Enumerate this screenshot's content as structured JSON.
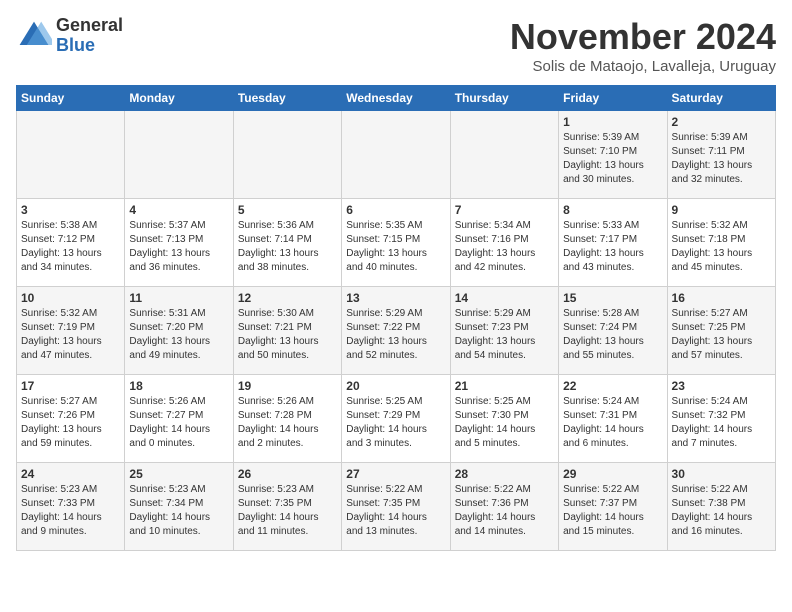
{
  "logo": {
    "general": "General",
    "blue": "Blue"
  },
  "header": {
    "month_title": "November 2024",
    "location": "Solis de Mataojo, Lavalleja, Uruguay"
  },
  "weekdays": [
    "Sunday",
    "Monday",
    "Tuesday",
    "Wednesday",
    "Thursday",
    "Friday",
    "Saturday"
  ],
  "weeks": [
    [
      {
        "day": "",
        "info": ""
      },
      {
        "day": "",
        "info": ""
      },
      {
        "day": "",
        "info": ""
      },
      {
        "day": "",
        "info": ""
      },
      {
        "day": "",
        "info": ""
      },
      {
        "day": "1",
        "info": "Sunrise: 5:39 AM\nSunset: 7:10 PM\nDaylight: 13 hours\nand 30 minutes."
      },
      {
        "day": "2",
        "info": "Sunrise: 5:39 AM\nSunset: 7:11 PM\nDaylight: 13 hours\nand 32 minutes."
      }
    ],
    [
      {
        "day": "3",
        "info": "Sunrise: 5:38 AM\nSunset: 7:12 PM\nDaylight: 13 hours\nand 34 minutes."
      },
      {
        "day": "4",
        "info": "Sunrise: 5:37 AM\nSunset: 7:13 PM\nDaylight: 13 hours\nand 36 minutes."
      },
      {
        "day": "5",
        "info": "Sunrise: 5:36 AM\nSunset: 7:14 PM\nDaylight: 13 hours\nand 38 minutes."
      },
      {
        "day": "6",
        "info": "Sunrise: 5:35 AM\nSunset: 7:15 PM\nDaylight: 13 hours\nand 40 minutes."
      },
      {
        "day": "7",
        "info": "Sunrise: 5:34 AM\nSunset: 7:16 PM\nDaylight: 13 hours\nand 42 minutes."
      },
      {
        "day": "8",
        "info": "Sunrise: 5:33 AM\nSunset: 7:17 PM\nDaylight: 13 hours\nand 43 minutes."
      },
      {
        "day": "9",
        "info": "Sunrise: 5:32 AM\nSunset: 7:18 PM\nDaylight: 13 hours\nand 45 minutes."
      }
    ],
    [
      {
        "day": "10",
        "info": "Sunrise: 5:32 AM\nSunset: 7:19 PM\nDaylight: 13 hours\nand 47 minutes."
      },
      {
        "day": "11",
        "info": "Sunrise: 5:31 AM\nSunset: 7:20 PM\nDaylight: 13 hours\nand 49 minutes."
      },
      {
        "day": "12",
        "info": "Sunrise: 5:30 AM\nSunset: 7:21 PM\nDaylight: 13 hours\nand 50 minutes."
      },
      {
        "day": "13",
        "info": "Sunrise: 5:29 AM\nSunset: 7:22 PM\nDaylight: 13 hours\nand 52 minutes."
      },
      {
        "day": "14",
        "info": "Sunrise: 5:29 AM\nSunset: 7:23 PM\nDaylight: 13 hours\nand 54 minutes."
      },
      {
        "day": "15",
        "info": "Sunrise: 5:28 AM\nSunset: 7:24 PM\nDaylight: 13 hours\nand 55 minutes."
      },
      {
        "day": "16",
        "info": "Sunrise: 5:27 AM\nSunset: 7:25 PM\nDaylight: 13 hours\nand 57 minutes."
      }
    ],
    [
      {
        "day": "17",
        "info": "Sunrise: 5:27 AM\nSunset: 7:26 PM\nDaylight: 13 hours\nand 59 minutes."
      },
      {
        "day": "18",
        "info": "Sunrise: 5:26 AM\nSunset: 7:27 PM\nDaylight: 14 hours\nand 0 minutes."
      },
      {
        "day": "19",
        "info": "Sunrise: 5:26 AM\nSunset: 7:28 PM\nDaylight: 14 hours\nand 2 minutes."
      },
      {
        "day": "20",
        "info": "Sunrise: 5:25 AM\nSunset: 7:29 PM\nDaylight: 14 hours\nand 3 minutes."
      },
      {
        "day": "21",
        "info": "Sunrise: 5:25 AM\nSunset: 7:30 PM\nDaylight: 14 hours\nand 5 minutes."
      },
      {
        "day": "22",
        "info": "Sunrise: 5:24 AM\nSunset: 7:31 PM\nDaylight: 14 hours\nand 6 minutes."
      },
      {
        "day": "23",
        "info": "Sunrise: 5:24 AM\nSunset: 7:32 PM\nDaylight: 14 hours\nand 7 minutes."
      }
    ],
    [
      {
        "day": "24",
        "info": "Sunrise: 5:23 AM\nSunset: 7:33 PM\nDaylight: 14 hours\nand 9 minutes."
      },
      {
        "day": "25",
        "info": "Sunrise: 5:23 AM\nSunset: 7:34 PM\nDaylight: 14 hours\nand 10 minutes."
      },
      {
        "day": "26",
        "info": "Sunrise: 5:23 AM\nSunset: 7:35 PM\nDaylight: 14 hours\nand 11 minutes."
      },
      {
        "day": "27",
        "info": "Sunrise: 5:22 AM\nSunset: 7:35 PM\nDaylight: 14 hours\nand 13 minutes."
      },
      {
        "day": "28",
        "info": "Sunrise: 5:22 AM\nSunset: 7:36 PM\nDaylight: 14 hours\nand 14 minutes."
      },
      {
        "day": "29",
        "info": "Sunrise: 5:22 AM\nSunset: 7:37 PM\nDaylight: 14 hours\nand 15 minutes."
      },
      {
        "day": "30",
        "info": "Sunrise: 5:22 AM\nSunset: 7:38 PM\nDaylight: 14 hours\nand 16 minutes."
      }
    ]
  ]
}
